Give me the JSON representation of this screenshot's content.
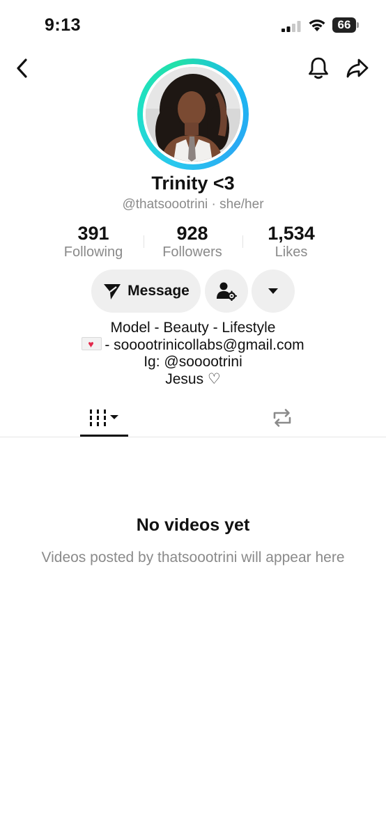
{
  "status_bar": {
    "time": "9:13",
    "battery": "66"
  },
  "profile": {
    "display_name": "Trinity <3",
    "handle_line": "@thatsoootrini · she/her"
  },
  "stats": {
    "following": {
      "value": "391",
      "label": "Following"
    },
    "followers": {
      "value": "928",
      "label": "Followers"
    },
    "likes": {
      "value": "1,534",
      "label": "Likes"
    }
  },
  "actions": {
    "message_label": "Message"
  },
  "bio": {
    "line1": "Model - Beauty - Lifestyle",
    "line2": "- sooootrinicollabs@gmail.com",
    "line3": "Ig: @sooootrini",
    "line4": "Jesus ♡"
  },
  "empty_state": {
    "title": "No videos yet",
    "description": "Videos posted by thatsoootrini will appear here"
  },
  "icons": {
    "back": "chevron-left-icon",
    "notification": "bell-icon",
    "share": "share-arrow-icon",
    "message": "paper-plane-icon",
    "add_friend": "user-settings-icon",
    "more": "caret-down-icon",
    "videos_tab": "grid-icon",
    "repost_tab": "repost-icon"
  },
  "colors": {
    "ring_start": "#29c7ee",
    "ring_end": "#22e0a8",
    "secondary_text": "#8a8a8a",
    "button_bg": "#efefef"
  }
}
